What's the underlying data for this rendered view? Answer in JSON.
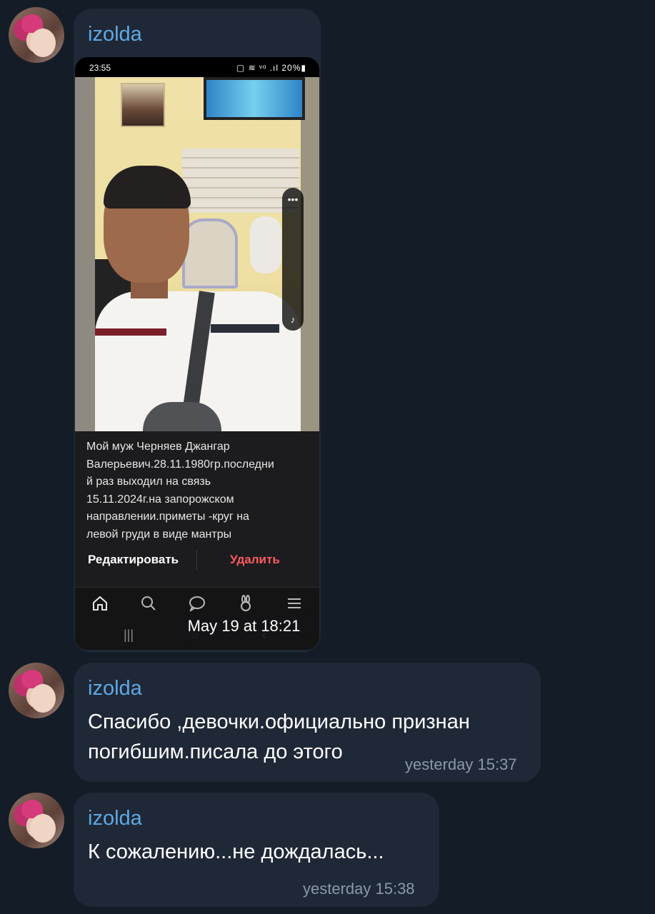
{
  "messages": [
    {
      "sender": "izolda",
      "screenshot": {
        "status_time": "23:55",
        "status_right": "▢ ≋ ᵛᵒ .ıl 20%▮",
        "caption": "Мой муж Черняев Джангар Валерьевич.28.11.1980гр.последни й раз выходил на связь 15.11.2024г.на запорожском направлении.приметы -круг на левой груди в виде мантры",
        "caption_lines": [
          "Мой муж Черняев Джангар",
          "Валерьевич.28.11.1980гр.последни",
          "й раз выходил на связь",
          "15.11.2024г.на запорожском",
          "направлении.приметы -круг на",
          "левой груди в виде мантры"
        ],
        "edit_label": "Редактировать",
        "delete_label": "Удалить",
        "nav_icons": [
          "home-icon",
          "search-icon",
          "chat-icon",
          "bunny-icon",
          "menu-icon"
        ]
      },
      "time": "May 19 at 18:21"
    },
    {
      "sender": "izolda",
      "text_lines": [
        "Спасибо ,девочки.официально признан",
        "погибшим.писала до этого"
      ],
      "time": "yesterday 15:37"
    },
    {
      "sender": "izolda",
      "text_lines": [
        "К сожалению...не дождалась..."
      ],
      "time": "yesterday 15:38"
    }
  ],
  "colors": {
    "background": "#141c27",
    "bubble": "#1f2836",
    "sender": "#5fa8e6",
    "time": "#8b98a8",
    "delete": "#ff5a5f"
  }
}
